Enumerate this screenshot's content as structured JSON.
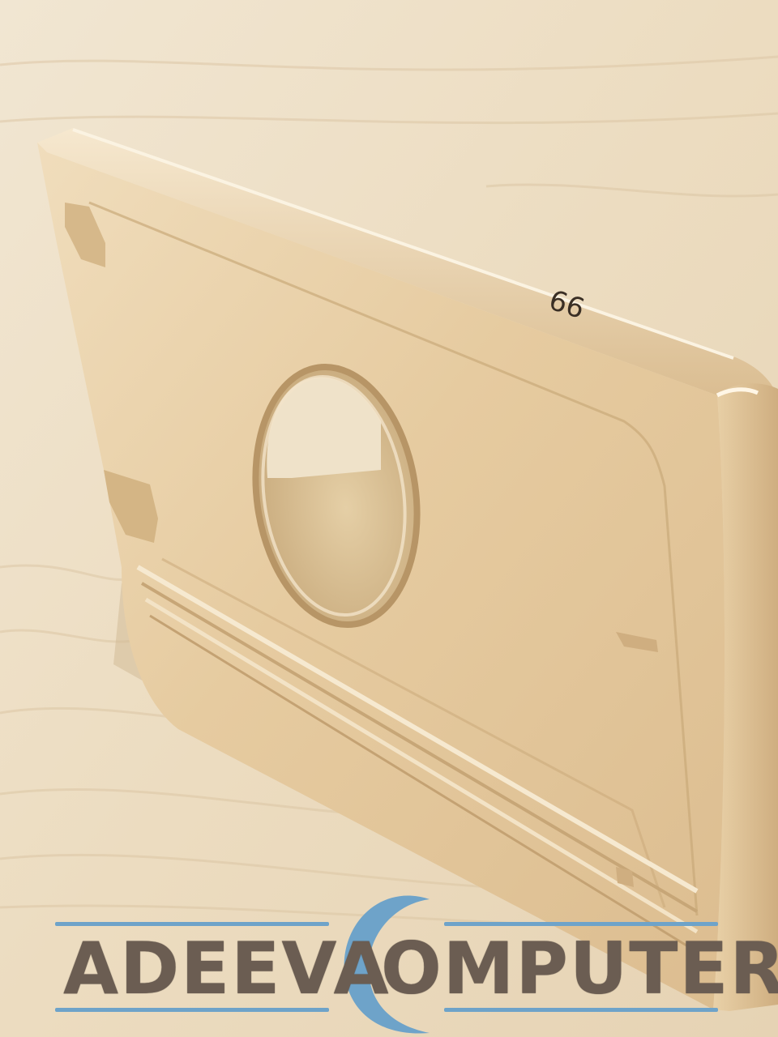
{
  "photo": {
    "subject": "Gold aluminium phone mould on a wooden table",
    "engraved_mark": "66",
    "colors": {
      "wood_light": "#efe2c9",
      "wood_dark": "#d9c7a8",
      "gold_face": "#e8cfa6",
      "gold_edge": "#c9a878",
      "hole_shadow": "#d2b88e"
    }
  },
  "watermark": {
    "word_left": "ADEEVA",
    "word_right": "OMPUTER",
    "text_color": "#6b5d52",
    "accent_color": "#6ea3c9"
  }
}
